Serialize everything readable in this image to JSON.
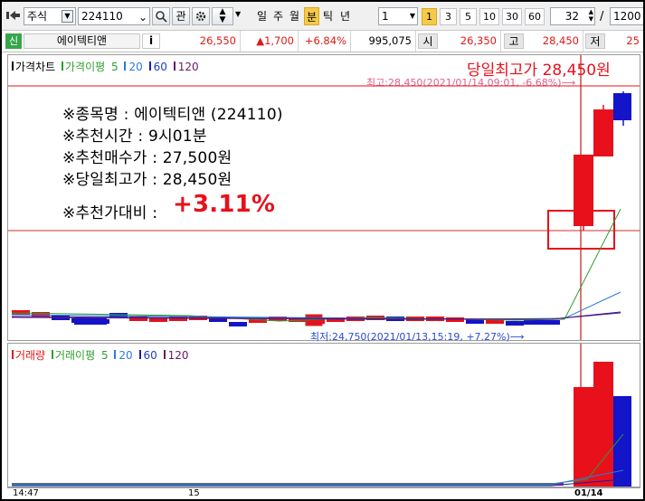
{
  "toolbar": {
    "market": "주식",
    "code": "224110",
    "btn_watch": "관",
    "periods": [
      "일",
      "주",
      "월",
      "분",
      "틱",
      "년"
    ],
    "active_period": "분",
    "interval": "1",
    "minutes": [
      "1",
      "3",
      "5",
      "10",
      "30",
      "60"
    ],
    "active_minute": "1",
    "count": "32",
    "slash": "/",
    "total": "1200"
  },
  "quote": {
    "badge": "신",
    "name": "에이텍티앤",
    "info": "i",
    "price": "26,550",
    "change": "▲1,700",
    "rate": "+6.84%",
    "volume": "995,075",
    "open_label": "시",
    "open": "26,350",
    "high_label": "고",
    "high": "28,450",
    "low_label": "저",
    "low": "25"
  },
  "price_pane": {
    "legend": {
      "title": "가격차트",
      "ma_label": "가격이평",
      "ma": [
        "5",
        "20",
        "60",
        "120"
      ]
    },
    "max_note": "최고:28,450(2021/01/14,09:01, -6.68%)⟶",
    "min_note": "최저:24,750(2021/01/13,15:19, +7.27%)⟶",
    "headline": "당일최고가 28,450원",
    "notes": [
      "※종목명 : 에이텍티앤 (224110)",
      "※추천시간 : 9시01분",
      "※추천매수가 : 27,500원",
      "※당일최고가 : 28,450원"
    ],
    "compare_label": "※추천가대비 :",
    "compare_value": "+3.11%"
  },
  "volume_pane": {
    "legend": {
      "title": "거래량",
      "ma_label": "거래이평",
      "ma": [
        "5",
        "20",
        "60",
        "120"
      ]
    }
  },
  "xaxis": {
    "labels": [
      "14:47",
      "15",
      "01/14"
    ]
  },
  "colors": {
    "up": "#e8101b",
    "down": "#1414c8",
    "ma5": "#2e9e2e",
    "ma20": "#2a7be0",
    "ma60": "#1c1cb0",
    "ma120": "#6a1b6a",
    "highlight": "#f7c948"
  }
}
